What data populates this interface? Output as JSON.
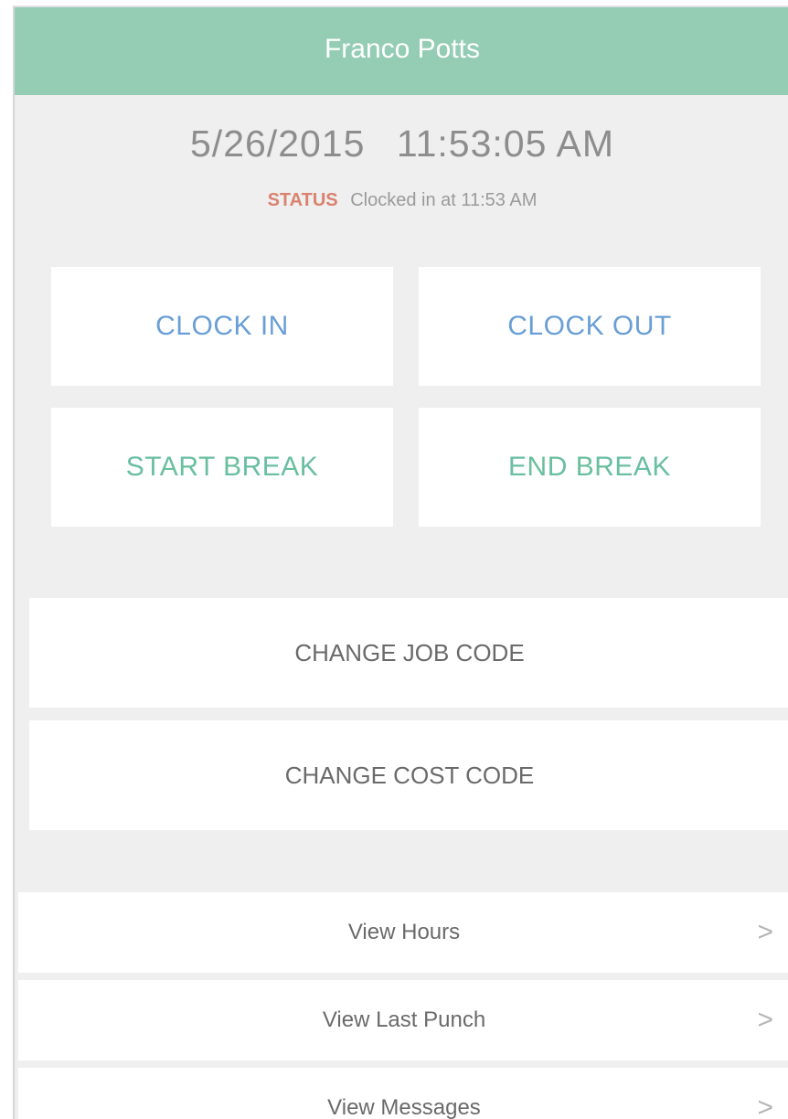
{
  "header": {
    "title": "Franco Potts"
  },
  "clock": {
    "date": "5/26/2015",
    "time": "11:53:05 AM",
    "status_label": "STATUS",
    "status_text": "Clocked in at 11:53 AM"
  },
  "actions": {
    "clock_in": "CLOCK IN",
    "clock_out": "CLOCK OUT",
    "start_break": "START BREAK",
    "end_break": "END BREAK",
    "change_job_code": "CHANGE JOB CODE",
    "change_cost_code": "CHANGE COST CODE"
  },
  "menu": [
    {
      "label": "View Hours",
      "chevron": ">"
    },
    {
      "label": "View Last Punch",
      "chevron": ">"
    },
    {
      "label": "View Messages",
      "chevron": ">"
    }
  ],
  "colors": {
    "header_bg": "#95cdb4",
    "clock_actions": "#6a9fd6",
    "break_actions": "#69bfa0",
    "status_label": "#d9826f"
  }
}
